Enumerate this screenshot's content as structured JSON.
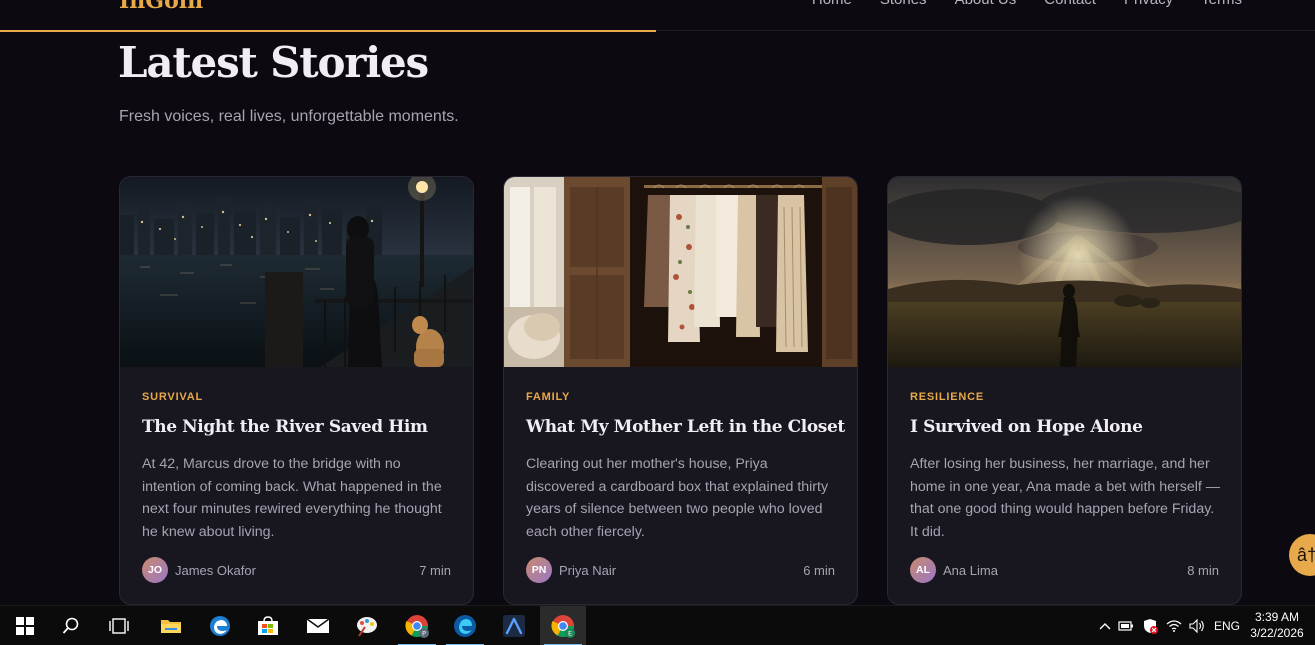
{
  "header": {
    "brand": "InGoin",
    "nav": [
      "Home",
      "Stories",
      "About Us",
      "Contact",
      "Privacy",
      "Terms"
    ]
  },
  "hero": {
    "title": "Latest Stories",
    "subtitle": "Fresh voices, real lives, unforgettable moments."
  },
  "cards": [
    {
      "category": "SURVIVAL",
      "title": "The Night the River Saved Him",
      "excerpt": "At 42, Marcus drove to the bridge with no intention of coming back. What happened in the next four minutes rewired everything he thought he knew about living.",
      "initials": "JO",
      "author": "James Okafor",
      "read_time": "7 min"
    },
    {
      "category": "FAMILY",
      "title": "What My Mother Left in the Closet",
      "excerpt": "Clearing out her mother's house, Priya discovered a cardboard box that explained thirty years of silence between two people who loved each other fiercely.",
      "initials": "PN",
      "author": "Priya Nair",
      "read_time": "6 min"
    },
    {
      "category": "RESILIENCE",
      "title": "I Survived on Hope Alone",
      "excerpt": "After losing her business, her marriage, and her home in one year, Ana made a bet with herself — that one good thing would happen before Friday. It did.",
      "initials": "AL",
      "author": "Ana Lima",
      "read_time": "8 min"
    }
  ],
  "fab": {
    "label": "â†"
  },
  "taskbar": {
    "apps": [
      "start-icon",
      "search-icon",
      "task-view-icon",
      "file-explorer-icon",
      "edge-icon",
      "store-icon",
      "mail-icon",
      "paint-icon",
      "chrome-profile-p-icon",
      "edge-dev-icon",
      "arc-icon",
      "chrome-profile-e-icon"
    ],
    "tray": {
      "language": "ENG",
      "time": "3:39 AM",
      "date": "3/22/2026"
    }
  },
  "colors": {
    "accent": "#e8a94a",
    "background": "#0c0a10",
    "card": "#18161e"
  }
}
